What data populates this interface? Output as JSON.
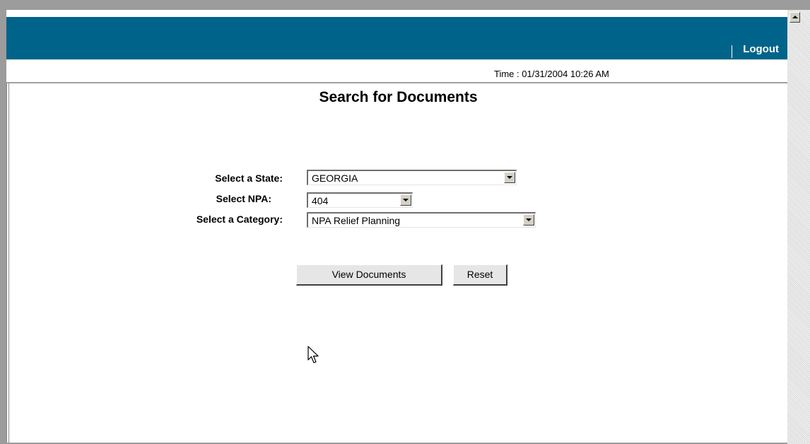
{
  "header": {
    "logout_label": "Logout"
  },
  "time_strip": {
    "text": "Time : 01/31/2004 10:26 AM"
  },
  "main": {
    "title": "Search for Documents",
    "form": {
      "state_label": "Select a State:",
      "state_value": "GEORGIA",
      "npa_label": "Select NPA:",
      "npa_value": "404",
      "category_label": "Select a Category:",
      "category_value": "NPA Relief Planning"
    },
    "buttons": {
      "view_label": "View Documents",
      "reset_label": "Reset"
    }
  },
  "colors": {
    "header_bg": "#00648a",
    "page_bg": "#ffffff",
    "frame": "#9c9c9c"
  },
  "icons": {
    "scroll_up": "scroll-up-arrow-icon",
    "dropdown": "chevron-down-icon",
    "cursor": "mouse-pointer-icon"
  }
}
